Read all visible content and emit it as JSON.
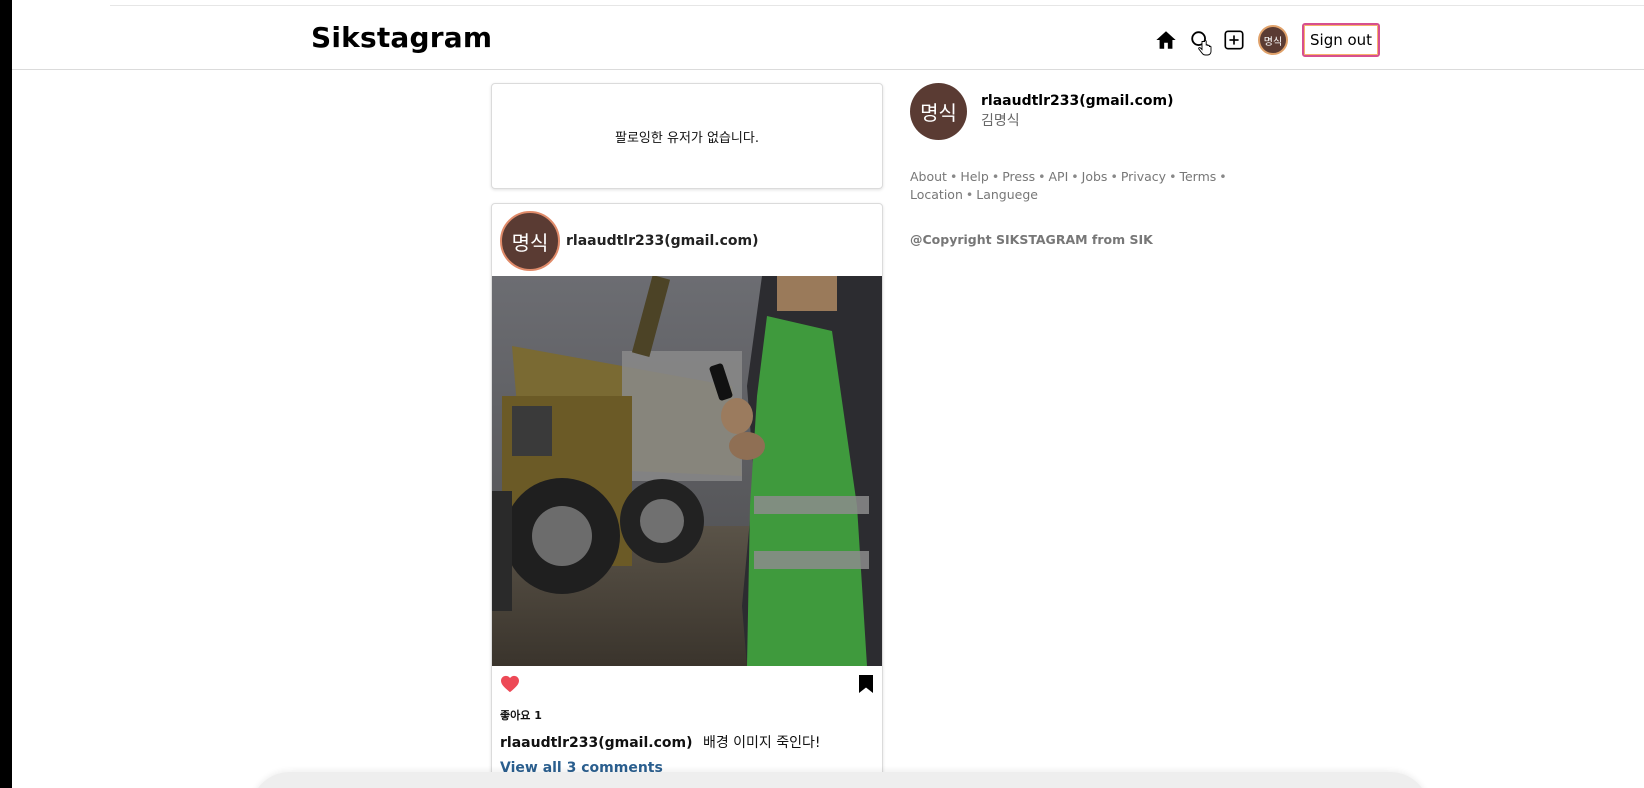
{
  "header": {
    "logo": "Sikstagram",
    "avatar_text": "명식",
    "signout_label": "Sign out",
    "icons": [
      "home-icon",
      "search-icon",
      "add-post-icon"
    ]
  },
  "feed": {
    "no_following_message": "팔로잉한 유저가 없습니다.",
    "post": {
      "avatar_text": "명식",
      "username": "rlaaudtlr233(gmail.com)",
      "image_description_icon": "photo-icon",
      "likes_text": "좋아요 1",
      "caption_user": "rlaaudtlr233(gmail.com)",
      "caption_text": "배경 이미지 죽인다!",
      "view_comments": "View all 3 comments",
      "liked": true
    }
  },
  "sidebar": {
    "avatar_text": "명식",
    "username": "rlaaudtlr233(gmail.com)",
    "full_name": "김명식",
    "links": [
      "About",
      "Help",
      "Press",
      "API",
      "Jobs",
      "Privacy",
      "Terms",
      "Location",
      "Languege"
    ],
    "copyright": "@Copyright SIKSTAGRAM from SIK"
  },
  "colors": {
    "avatar_bg": "#5a3b33",
    "like_red": "#ed4956",
    "link_blue": "#2b5f8f",
    "signout_border": "#d64f8f"
  }
}
